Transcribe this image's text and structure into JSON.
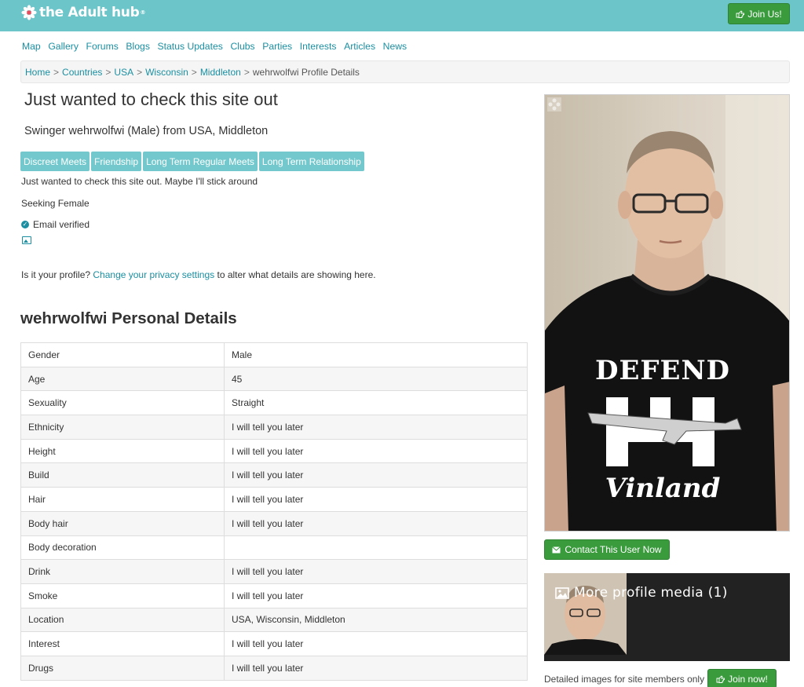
{
  "header": {
    "logo_text": "the Adult hub",
    "logo_mark": "®",
    "join_label": "Join Us!",
    "join_icon": "hand-pointer-icon",
    "bg_color": "#6cc5c9"
  },
  "nav": {
    "items": [
      "Map",
      "Gallery",
      "Forums",
      "Blogs",
      "Status Updates",
      "Clubs",
      "Parties",
      "Interests",
      "Articles",
      "News"
    ]
  },
  "breadcrumb": {
    "items": [
      "Home",
      "Countries",
      "USA",
      "Wisconsin",
      "Middleton"
    ],
    "separator": ">",
    "current": "wehrwolfwi Profile Details"
  },
  "profile": {
    "headline": "Just wanted to check this site out",
    "subtitle": "Swinger wehrwolfwi (Male) from USA, Middleton",
    "tags": [
      "Discreet Meets",
      "Friendship",
      "Long Term Regular Meets",
      "Long Term Relationship"
    ],
    "about": "Just wanted to check this site out. Maybe I'll stick around",
    "seeking": "Seeking Female",
    "verified": "Email verified",
    "privacy_prefix": "Is it your profile?",
    "privacy_link": "Change your privacy settings",
    "privacy_suffix": "to alter what details are showing here."
  },
  "details": {
    "title": "wehrwolfwi Personal Details",
    "rows": [
      {
        "label": "Gender",
        "value": "Male"
      },
      {
        "label": "Age",
        "value": "45"
      },
      {
        "label": "Sexuality",
        "value": "Straight"
      },
      {
        "label": "Ethnicity",
        "value": "I will tell you later"
      },
      {
        "label": "Height",
        "value": "I will tell you later"
      },
      {
        "label": "Build",
        "value": "I will tell you later"
      },
      {
        "label": "Hair",
        "value": "I will tell you later"
      },
      {
        "label": "Body hair",
        "value": "I will tell you later"
      },
      {
        "label": "Body decoration",
        "value": ""
      },
      {
        "label": "Drink",
        "value": "I will tell you later"
      },
      {
        "label": "Smoke",
        "value": "I will tell you later"
      },
      {
        "label": "Location",
        "value": "USA, Wisconsin, Middleton"
      },
      {
        "label": "Interest",
        "value": "I will tell you later"
      },
      {
        "label": "Drugs",
        "value": "I will tell you later"
      }
    ]
  },
  "sidebar": {
    "contact_label": "Contact This User Now",
    "media_label": "More profile media (1)",
    "members_note": "Detailed images for site members only",
    "join_now_label": "Join now!"
  },
  "photo_shirt": {
    "line1": "DEFEND",
    "line2": "Vinland"
  }
}
